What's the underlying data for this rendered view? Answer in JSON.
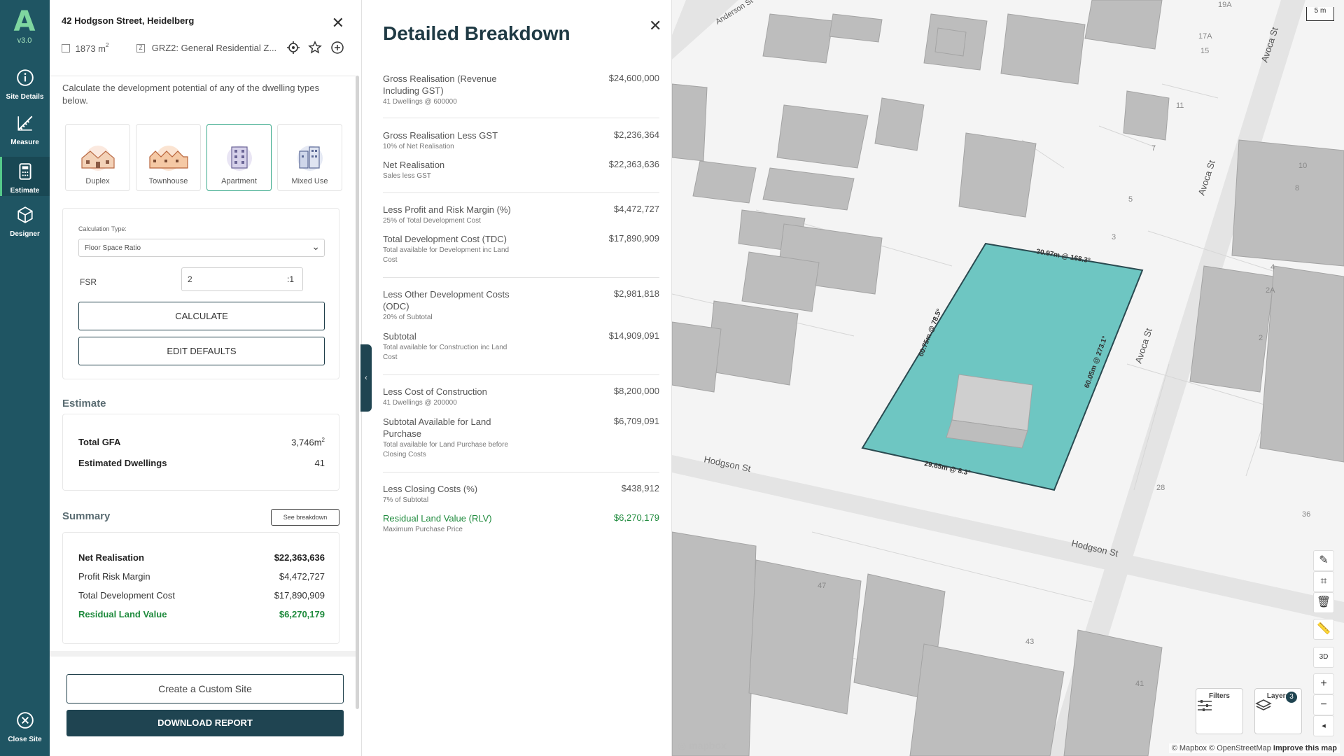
{
  "rail": {
    "version": "v3.0",
    "items": [
      {
        "label": "Site Details",
        "icon": "info-icon"
      },
      {
        "label": "Measure",
        "icon": "ruler-icon"
      },
      {
        "label": "Estimate",
        "icon": "calculator-icon"
      },
      {
        "label": "Designer",
        "icon": "cube-icon"
      }
    ],
    "close_label": "Close Site"
  },
  "site": {
    "address": "42 Hodgson Street, Heidelberg",
    "area_value": "1873 m",
    "area_sup": "2",
    "zone": "GRZ2: General Residential Z..."
  },
  "estimate_panel": {
    "intro": "Calculate the development potential of any of the dwelling types below.",
    "types": [
      {
        "label": "Duplex",
        "selected": false
      },
      {
        "label": "Townhouse",
        "selected": false
      },
      {
        "label": "Apartment",
        "selected": true
      },
      {
        "label": "Mixed Use",
        "selected": false
      }
    ],
    "calc_type_label": "Calculation Type:",
    "calc_type_value": "Floor Space Ratio",
    "fsr_label": "FSR",
    "fsr_value": "2",
    "fsr_unit": ":1",
    "calculate_label": "CALCULATE",
    "edit_defaults_label": "EDIT DEFAULTS",
    "estimate_title": "Estimate",
    "total_gfa_label": "Total GFA",
    "total_gfa_value": "3,746m",
    "total_gfa_sup": "2",
    "dwellings_label": "Estimated Dwellings",
    "dwellings_value": "41",
    "summary_title": "Summary",
    "see_breakdown_label": "See breakdown",
    "summary": [
      {
        "label": "Net Realisation",
        "value": "$22,363,636",
        "style": "bold"
      },
      {
        "label": "Profit Risk Margin",
        "value": "$4,472,727",
        "style": "normal"
      },
      {
        "label": "Total Development Cost",
        "value": "$17,890,909",
        "style": "normal"
      },
      {
        "label": "Residual Land Value",
        "value": "$6,270,179",
        "style": "green"
      }
    ],
    "custom_site_label": "Create a Custom Site",
    "download_label": "DOWNLOAD REPORT"
  },
  "breakdown": {
    "title": "Detailed Breakdown",
    "items": [
      {
        "label": "Gross Realisation (Revenue Including GST)",
        "sub": "41 Dwellings @ 600000",
        "value": "$24,600,000"
      },
      {
        "label": "Gross Realisation Less GST",
        "sub": "10% of Net Realisation",
        "value": "$2,236,364"
      },
      {
        "label": "Net Realisation",
        "sub": "Sales less GST",
        "value": "$22,363,636"
      },
      {
        "label": "Less Profit and Risk Margin (%)",
        "sub": "25% of Total Development Cost",
        "value": "$4,472,727"
      },
      {
        "label": "Total Development Cost (TDC)",
        "sub": "Total available for Development inc Land Cost",
        "value": "$17,890,909"
      },
      {
        "label": "Less Other Development Costs (ODC)",
        "sub": "20% of Subtotal",
        "value": "$2,981,818"
      },
      {
        "label": "Subtotal",
        "sub": "Total available for Construction inc Land Cost",
        "value": "$14,909,091"
      },
      {
        "label": "Less Cost of Construction",
        "sub": "41 Dwellings @ 200000",
        "value": "$8,200,000"
      },
      {
        "label": "Subtotal Available for Land Purchase",
        "sub": "Total available for Land Purchase before Closing Costs",
        "value": "$6,709,091"
      },
      {
        "label": "Less Closing Costs (%)",
        "sub": "7% of Subtotal",
        "value": "$438,912"
      },
      {
        "label": "Residual Land Value (RLV)",
        "sub": "Maximum Purchase Price",
        "value": "$6,270,179"
      }
    ]
  },
  "map": {
    "streets": [
      "Hodgson St",
      "Hodgson St",
      "Avoca St",
      "Avoca St",
      "Avoca St",
      "Anderson St"
    ],
    "dimensions": [
      "30.97m @ 168.3°",
      "60.75m @ 78.5°",
      "60.05m @ 273.1°",
      "29.65m @ 8.3°"
    ],
    "lot_numbers": [
      "19A",
      "17A",
      "15",
      "11",
      "7",
      "5",
      "3",
      "10",
      "8",
      "4",
      "2A",
      "36",
      "43",
      "47",
      "41",
      "2",
      "28"
    ],
    "scale": "5 m",
    "filters_label": "Filters",
    "layers_label": "Layers",
    "layers_count": "3",
    "mapbox": "mapbox",
    "attribution_a": "© Mapbox © OpenStreetMap",
    "attribution_b": "Improve this map",
    "colors": {
      "site_fill": "#6ec6c2",
      "building": "#bdbdbd",
      "road": "#e7e7e7"
    }
  }
}
